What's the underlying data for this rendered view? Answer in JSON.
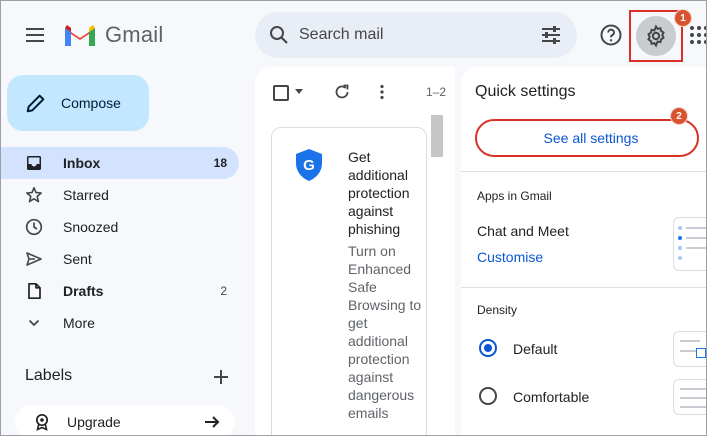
{
  "header": {
    "logo_text": "Gmail",
    "search_placeholder": "Search mail",
    "gear_badge": "1"
  },
  "sidebar": {
    "compose_label": "Compose",
    "items": [
      {
        "label": "Inbox",
        "count": "18",
        "icon": "inbox-icon"
      },
      {
        "label": "Starred",
        "count": "",
        "icon": "star-icon"
      },
      {
        "label": "Snoozed",
        "count": "",
        "icon": "clock-icon"
      },
      {
        "label": "Sent",
        "count": "",
        "icon": "send-icon"
      },
      {
        "label": "Drafts",
        "count": "2",
        "icon": "draft-icon"
      },
      {
        "label": "More",
        "count": "",
        "icon": "chevron-down-icon"
      }
    ],
    "labels_title": "Labels",
    "upgrade_label": "Upgrade"
  },
  "main": {
    "pager": "1–2",
    "promo": {
      "title": "Get additional protection against phishing",
      "body": "Turn on Enhanced Safe Browsing to get additional protection against dangerous emails"
    }
  },
  "quick_settings": {
    "title": "Quick settings",
    "see_all_label": "See all settings",
    "see_all_badge": "2",
    "apps_section": "Apps in Gmail",
    "chat_meet": "Chat and Meet",
    "customise": "Customise",
    "density_section": "Density",
    "density_options": [
      {
        "label": "Default",
        "selected": true
      },
      {
        "label": "Comfortable",
        "selected": false
      }
    ]
  },
  "colors": {
    "accent": "#0b57d0",
    "compose_bg": "#c2e7ff",
    "active_nav": "#d3e3fd",
    "highlight_red": "#d93025",
    "badge": "#d8532f"
  }
}
